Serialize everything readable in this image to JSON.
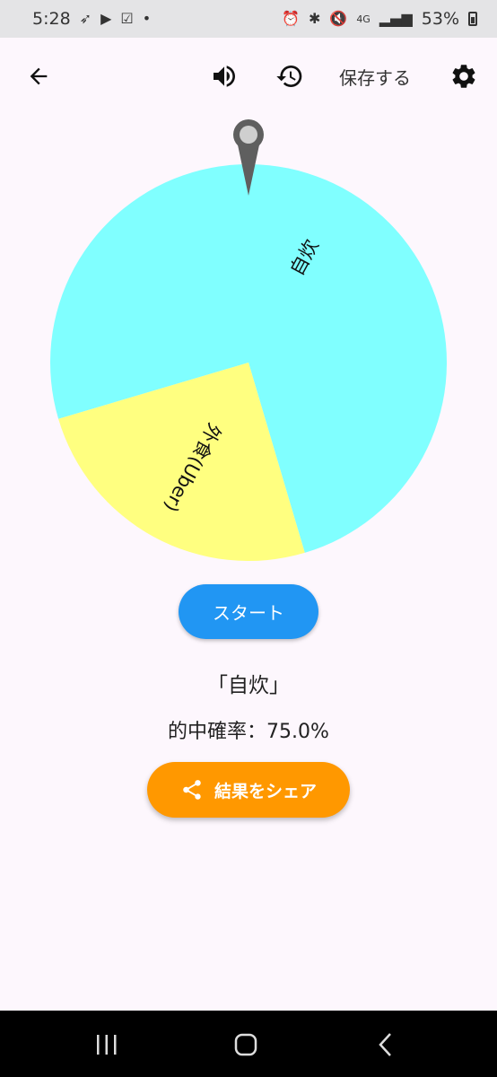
{
  "status_bar": {
    "time": "5:28",
    "network": "4G",
    "battery": "53%"
  },
  "toolbar": {
    "back_icon": "arrow-left-icon",
    "sound_icon": "volume-icon",
    "history_icon": "history-icon",
    "save_label": "保存する",
    "settings_icon": "gear-icon"
  },
  "wheel": {
    "segments": [
      {
        "label": "自炊",
        "fraction": 0.75,
        "color": "#80ffff"
      },
      {
        "label": "外食(Uber)",
        "fraction": 0.25,
        "color": "#ffff80"
      }
    ]
  },
  "actions": {
    "start_label": "スタート",
    "share_label": "結果をシェア"
  },
  "result": {
    "text": "「自炊」",
    "hit_rate": "的中確率：75.0%"
  }
}
